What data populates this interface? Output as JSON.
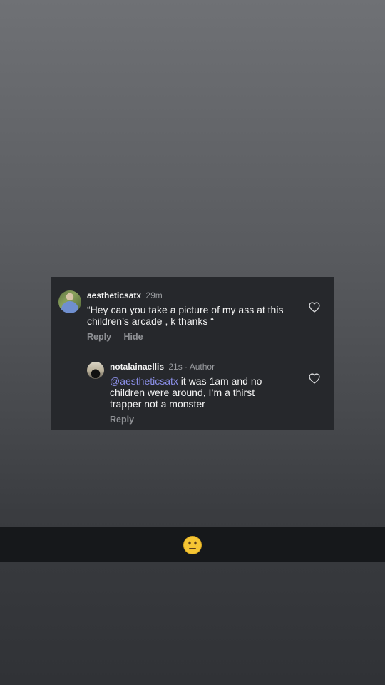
{
  "comment": {
    "username": "aestheticsatx",
    "time": "29m",
    "text": "“Hey can you take a picture of my ass at this children’s arcade , k thanks “",
    "reply_label": "Reply",
    "hide_label": "Hide",
    "avatar_icon": "profile-photo-icon",
    "like_icon": "heart-outline-icon"
  },
  "reply": {
    "username": "notalainaellis",
    "time_author": "21s · Author",
    "mention": "@aestheticsatx",
    "text": " it was 1am and no children were around, I’m a thirst trapper not a monster",
    "reply_label": "Reply",
    "avatar_icon": "profile-photo-icon",
    "like_icon": "heart-outline-icon"
  },
  "bottom_bar": {
    "emoji_icon": "neutral-face-emoji"
  },
  "colors": {
    "card_bg": "#26282c",
    "mention": "#8b8fe8",
    "emoji_yellow": "#f5c534"
  }
}
